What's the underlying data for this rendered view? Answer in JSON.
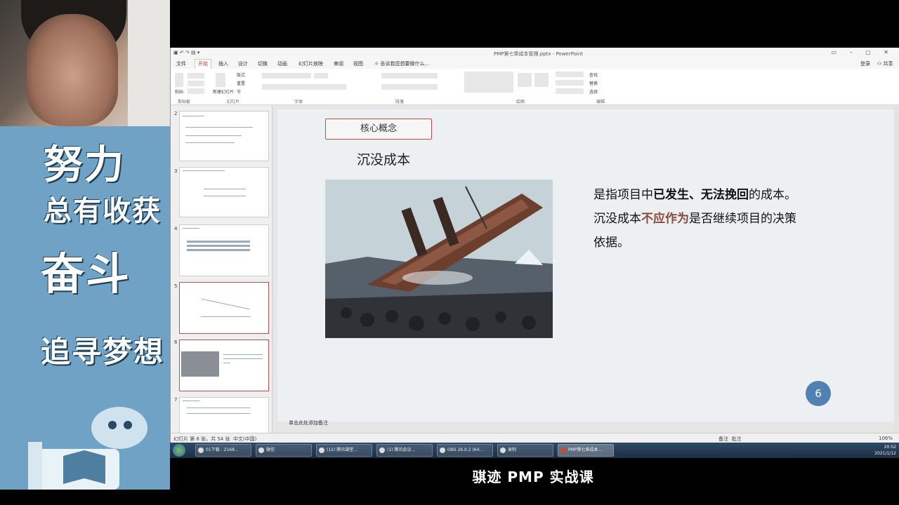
{
  "overlay": {
    "slogan_line1": "努力",
    "slogan_line2": "总有收获",
    "slogan_line3": "奋斗",
    "slogan_line4": "追寻梦想"
  },
  "window": {
    "title": "PMP第七章成本管理.pptx - PowerPoint",
    "tabs": [
      "文件",
      "开始",
      "插入",
      "设计",
      "切换",
      "动画",
      "幻灯片放映",
      "审阅",
      "视图"
    ],
    "tell_me": "告诉我您想要做什么...",
    "account": "登录",
    "share": "共享",
    "groups": [
      "剪贴板",
      "幻灯片",
      "字体",
      "段落",
      "绘图",
      "编辑"
    ],
    "ribbon_items": [
      "粘贴",
      "新建幻灯片",
      "版式",
      "重置",
      "节",
      "查找",
      "替换",
      "选择"
    ]
  },
  "thumbnails": [
    {
      "num": "2"
    },
    {
      "num": "3"
    },
    {
      "num": "4"
    },
    {
      "num": "5"
    },
    {
      "num": "6"
    },
    {
      "num": "7"
    }
  ],
  "slide": {
    "concept_label": "核心概念",
    "heading": "沉没成本",
    "desc_p1_pre": "是指项目中",
    "desc_p1_bold": "已发生、无法挽回",
    "desc_p1_post": "的成本。",
    "desc_p2_pre": "沉没成本",
    "desc_p2_red": "不应作为",
    "desc_p2_post": "是否继续项目的决策",
    "desc_p3": "依据。",
    "page_number": "6"
  },
  "notes_placeholder": "单击此处添加备注",
  "status": {
    "slide_info": "幻灯片 第 6 张，共 54 张",
    "language": "中文(中国)",
    "notes": "备注",
    "comments": "批注",
    "zoom": "106%"
  },
  "taskbar": {
    "tasks": [
      "01下载 - 2168...",
      "微信",
      "(12) 腾讯课堂...",
      "(1) 腾讯会议...",
      "OBS 26.0.2 (64...",
      "录制",
      "PMP第七章成本..."
    ],
    "time": "20:52",
    "date": "2021/1/12"
  },
  "caption": "骐迹 PMP 实战课"
}
